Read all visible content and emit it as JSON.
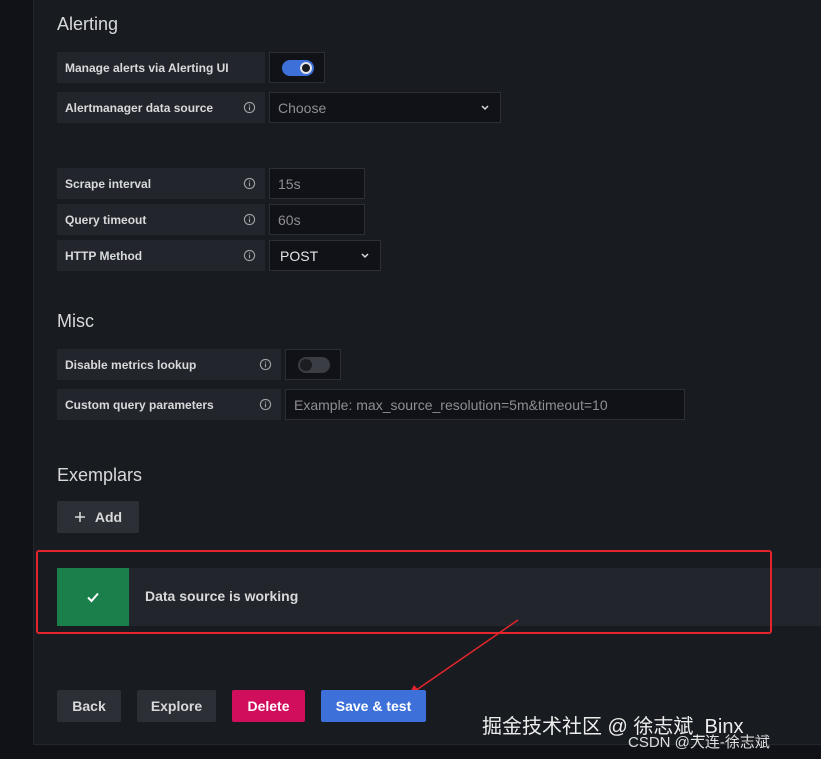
{
  "alerting": {
    "title": "Alerting",
    "manage_label": "Manage alerts via Alerting UI",
    "manage_enabled": true,
    "am_source_label": "Alertmanager data source",
    "am_source_placeholder": "Choose"
  },
  "settings": {
    "scrape_label": "Scrape interval",
    "scrape_value": "15s",
    "timeout_label": "Query timeout",
    "timeout_value": "60s",
    "method_label": "HTTP Method",
    "method_value": "POST"
  },
  "misc": {
    "title": "Misc",
    "disable_lookup_label": "Disable metrics lookup",
    "disable_lookup_enabled": false,
    "custom_params_label": "Custom query parameters",
    "custom_params_placeholder": "Example: max_source_resolution=5m&timeout=10"
  },
  "exemplars": {
    "title": "Exemplars",
    "add_label": "Add"
  },
  "alert": {
    "message": "Data source is working",
    "color": "#1a7f4b"
  },
  "actions": {
    "back": "Back",
    "explore": "Explore",
    "delete": "Delete",
    "save_test": "Save & test"
  },
  "watermark": {
    "line1": "掘金技术社区 @ 徐志斌_Binx",
    "line2": "CSDN @大连-徐志斌"
  },
  "icons": {
    "info": "info-circle-icon",
    "chevron": "chevron-down-icon",
    "plus": "plus-icon",
    "check": "check-icon"
  }
}
